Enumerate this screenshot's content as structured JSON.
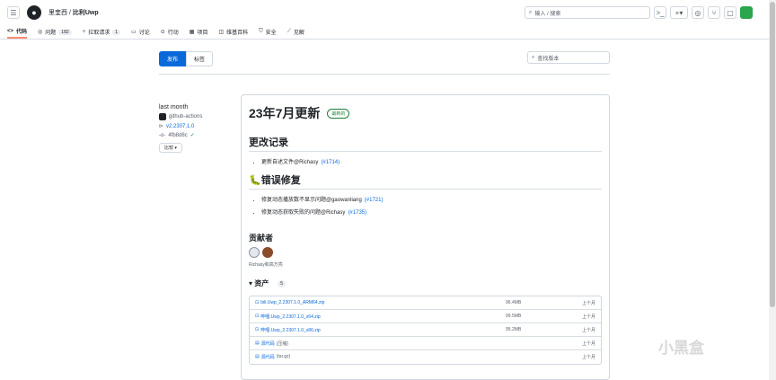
{
  "header": {
    "owner": "里奎西",
    "separator": "/",
    "repo": "比利Uwp",
    "search_placeholder": "输入 / 搜索",
    "menu_icon": "hamburger-icon",
    "logo_icon": "github-logo-icon"
  },
  "tabs": [
    {
      "label": "代码",
      "icon": "code-icon"
    },
    {
      "label": "问题",
      "count": "182",
      "icon": "issue-icon"
    },
    {
      "label": "拉取请求",
      "count": "1",
      "icon": "pr-icon"
    },
    {
      "label": "讨论",
      "icon": "discussion-icon"
    },
    {
      "label": "行动",
      "icon": "actions-icon"
    },
    {
      "label": "项目",
      "icon": "project-icon"
    },
    {
      "label": "维基百科",
      "icon": "wiki-icon"
    },
    {
      "label": "安全",
      "icon": "shield-icon"
    },
    {
      "label": "见解",
      "icon": "graph-icon"
    }
  ],
  "subnav": {
    "releases": "发布",
    "tags": "标签",
    "search_placeholder": "查找版本"
  },
  "meta": {
    "date": "last month",
    "author": "github-actions",
    "tag": "v2.2307.1.0",
    "commit": "4fb8d8c",
    "compare": "比较"
  },
  "release": {
    "title": "23年7月更新",
    "latest": "最新的",
    "changelog_heading": "更改记录",
    "changelog": [
      {
        "text": "更新自述文件@Richasy",
        "pr": "(#1714)"
      }
    ],
    "bugfix_heading": "🐛错误修复",
    "bugfix": [
      {
        "text": "修复动态播放数不显示问题@gaowanliang",
        "pr": "(#1721)"
      },
      {
        "text": "修复动态获取失败的问题@Richasy",
        "pr": "(#1735)"
      }
    ],
    "contributors_heading": "贡献者",
    "contributors_names": "Richasy和高万亮",
    "assets_heading": "资产",
    "assets_count": "5",
    "assets": [
      {
        "name": "bili.Uwp_2.2307.1.0_ARM64.zip",
        "size": "96.4MB",
        "date": "上个月"
      },
      {
        "name": "哔哩.Uwp_2.2307.1.0_x64.zip",
        "size": "99.5MB",
        "date": "上个月"
      },
      {
        "name": "哔哩.Uwp_2.2307.1.0_x86.zip",
        "size": "95.2MB",
        "date": "上个月"
      },
      {
        "name": "源代码",
        "suffix": "(压缩)",
        "size": "",
        "date": "上个月"
      },
      {
        "name": "源代码",
        "suffix": "(tar.gz)",
        "size": "",
        "date": "上个月"
      }
    ]
  },
  "watermark": "小黑盒",
  "colors": {
    "accent": "#0969da",
    "active_tab": "#fd8c73",
    "success": "#1a7f37"
  }
}
